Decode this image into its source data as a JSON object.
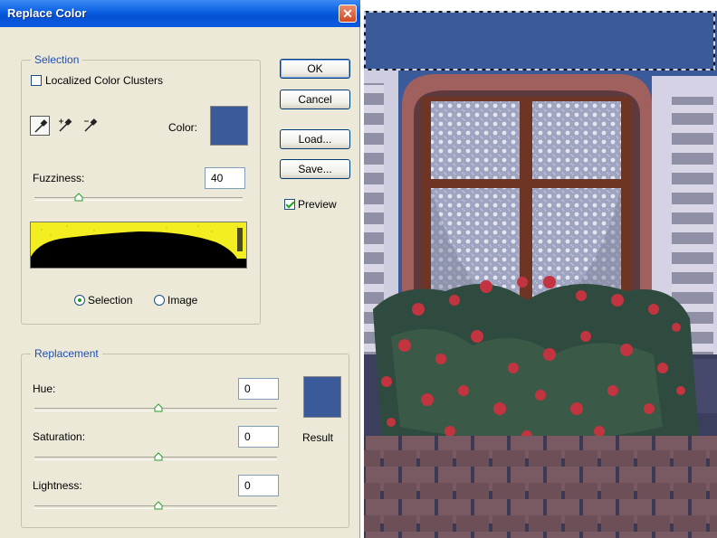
{
  "dialog": {
    "title": "Replace Color",
    "close_glyph": "✕",
    "selection_group": {
      "legend": "Selection",
      "localized_label": "Localized Color Clusters",
      "localized_checked": false,
      "color_label": "Color:",
      "fuzziness_label": "Fuzziness:",
      "fuzziness_value": "40",
      "fuzziness_fraction": 0.2,
      "view_options": [
        "Selection",
        "Image"
      ],
      "view_selected": "Selection"
    },
    "replacement_group": {
      "legend": "Replacement",
      "hue_label": "Hue:",
      "hue_value": "0",
      "saturation_label": "Saturation:",
      "saturation_value": "0",
      "lightness_label": "Lightness:",
      "lightness_value": "0",
      "result_label": "Result"
    },
    "buttons": {
      "ok": "OK",
      "cancel": "Cancel",
      "load": "Load...",
      "save": "Save..."
    },
    "preview_label": "Preview",
    "preview_checked": true,
    "colors": {
      "selected_color": "#3a5a99",
      "result_color": "#3a5a99",
      "mask_yellow": "#f2ee22"
    },
    "icons": [
      "eyedropper-icon",
      "eyedropper-plus-icon",
      "eyedropper-minus-icon",
      "close-icon",
      "slider-thumb-icon"
    ]
  }
}
